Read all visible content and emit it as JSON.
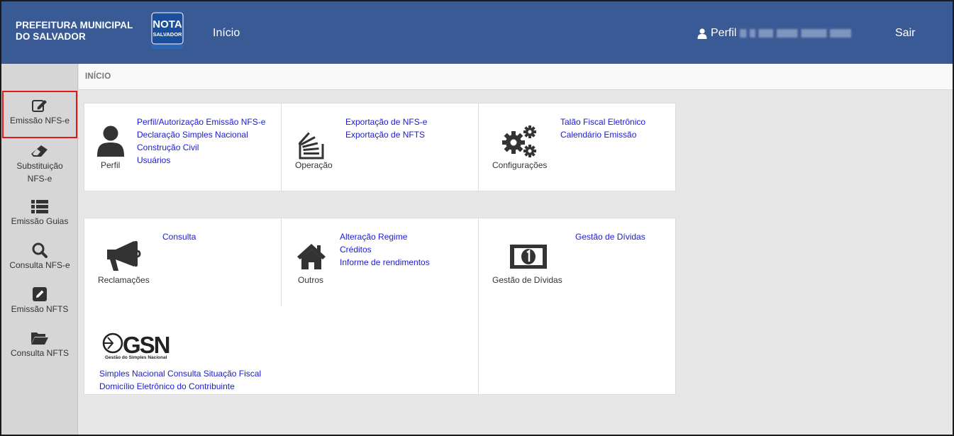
{
  "header": {
    "brand_line1": "PREFEITURA MUNICIPAL",
    "brand_line2": "DO SALVADOR",
    "logo_line1": "NOTA",
    "logo_line2": "SALVADOR",
    "nav_home": "Início",
    "profile_label": "Perfil",
    "logout": "Sair",
    "color": "#3a5a95"
  },
  "sidebar": {
    "items": [
      {
        "label": "Emissão NFS-e",
        "icon": "edit-icon"
      },
      {
        "label": "Substituição NFS-e",
        "icon": "eraser-icon"
      },
      {
        "label": "Emissão Guias",
        "icon": "list-icon"
      },
      {
        "label": "Consulta NFS-e",
        "icon": "search-icon"
      },
      {
        "label": "Emissão NFTS",
        "icon": "pencil-square-icon"
      },
      {
        "label": "Consulta NFTS",
        "icon": "folder-open-icon"
      }
    ]
  },
  "breadcrumb": "INÍCIO",
  "cards": {
    "perfil": {
      "title": "Perfil",
      "links": [
        "Perfil/Autorização Emissão NFS-e",
        "Declaração Simples Nacional",
        "Construção Civil",
        "Usuários"
      ]
    },
    "operacao": {
      "title": "Operação",
      "links": [
        "Exportação de NFS-e",
        "Exportação de NFTS"
      ]
    },
    "config": {
      "title": "Configurações",
      "links": [
        "Talão Fiscal Eletrônico",
        "Calendário Emissão"
      ]
    },
    "reclamacoes": {
      "title": "Reclamações",
      "links": [
        "Consulta"
      ]
    },
    "outros": {
      "title": "Outros",
      "links": [
        "Alteração Regime",
        "Créditos",
        "Informe de rendimentos"
      ]
    },
    "gestao": {
      "title": "Gestão de Dívidas",
      "links": [
        "Gestão de Dívidas"
      ]
    },
    "gsn": {
      "logo_text": "GSN",
      "logo_sub": "Gestão do Simples Nacional",
      "links": [
        "Simples Nacional Consulta Situação Fiscal",
        "Domicílio Eletrônico do Contribuinte"
      ]
    }
  },
  "colors": {
    "link": "#1a1ad0",
    "active_border": "#e01818"
  }
}
